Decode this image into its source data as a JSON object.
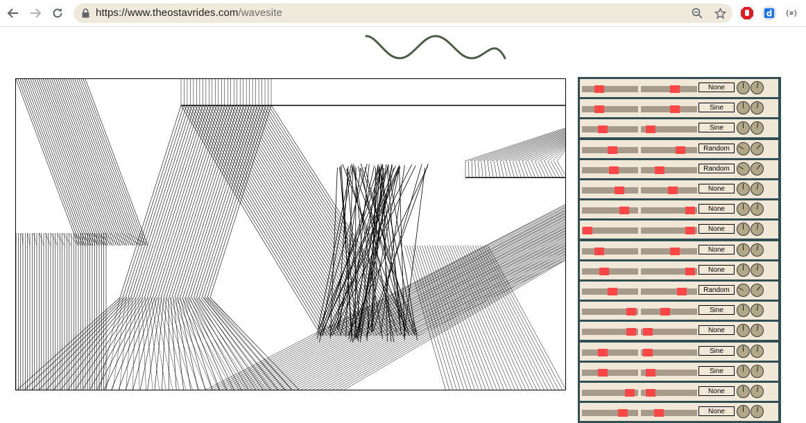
{
  "browser": {
    "url_host": "https://www.theostavrides.com",
    "url_path": "/wavesite",
    "icons": [
      "back-arrow-icon",
      "forward-arrow-icon",
      "reload-icon",
      "lock-icon",
      "zoom-out-icon",
      "bookmark-star-icon",
      "adblock-hand-icon",
      "dashlane-d-icon",
      "json-viewer-icon"
    ],
    "ext_json_label": "{≡}"
  },
  "logo": {
    "icon": "sine-wave-logo-icon",
    "color": "#4a5d43"
  },
  "colors": {
    "panel_bg": "#2f4f55",
    "row_bg": "#f0e7d7",
    "slider_track": "#a69b8b",
    "slider_thumb": "#ff4646",
    "knob": "#b2a888"
  },
  "controls": [
    {
      "wave": "None",
      "s1": 0.27,
      "s2": 0.63,
      "k1": 0,
      "k2": 10
    },
    {
      "wave": "Sine",
      "s1": 0.27,
      "s2": 0.63,
      "k1": 0,
      "k2": 10
    },
    {
      "wave": "Sine",
      "s1": 0.35,
      "s2": 0.1,
      "k1": 0,
      "k2": 10
    },
    {
      "wave": "Random",
      "s1": 0.55,
      "s2": 0.75,
      "k1": -60,
      "k2": 40
    },
    {
      "wave": "Random",
      "s1": 0.58,
      "s2": 0.3,
      "k1": -60,
      "k2": 40
    },
    {
      "wave": "None",
      "s1": 0.7,
      "s2": 0.58,
      "k1": 0,
      "k2": 10
    },
    {
      "wave": "None",
      "s1": 0.8,
      "s2": 0.95,
      "k1": 0,
      "k2": 10
    },
    {
      "wave": "None",
      "s1": 0.02,
      "s2": 0.95,
      "k1": 0,
      "k2": 10
    },
    {
      "wave": "None",
      "s1": 0.27,
      "s2": 0.63,
      "k1": 0,
      "k2": 10
    },
    {
      "wave": "None",
      "s1": 0.38,
      "s2": 0.95,
      "k1": 0,
      "k2": 10
    },
    {
      "wave": "Random",
      "s1": 0.55,
      "s2": 0.78,
      "k1": -60,
      "k2": 40
    },
    {
      "wave": "Sine",
      "s1": 0.95,
      "s2": 0.42,
      "k1": 0,
      "k2": 10
    },
    {
      "wave": "None",
      "s1": 0.95,
      "s2": 0.05,
      "k1": 0,
      "k2": 10
    },
    {
      "wave": "Sine",
      "s1": 0.35,
      "s2": 0.05,
      "k1": 0,
      "k2": 10
    },
    {
      "wave": "Sine",
      "s1": 0.35,
      "s2": 0.1,
      "k1": 0,
      "k2": 10
    },
    {
      "wave": "None",
      "s1": 0.92,
      "s2": 0.1,
      "k1": 0,
      "k2": 10
    },
    {
      "wave": "None",
      "s1": 0.78,
      "s2": 0.28,
      "k1": 0,
      "k2": 10
    }
  ]
}
